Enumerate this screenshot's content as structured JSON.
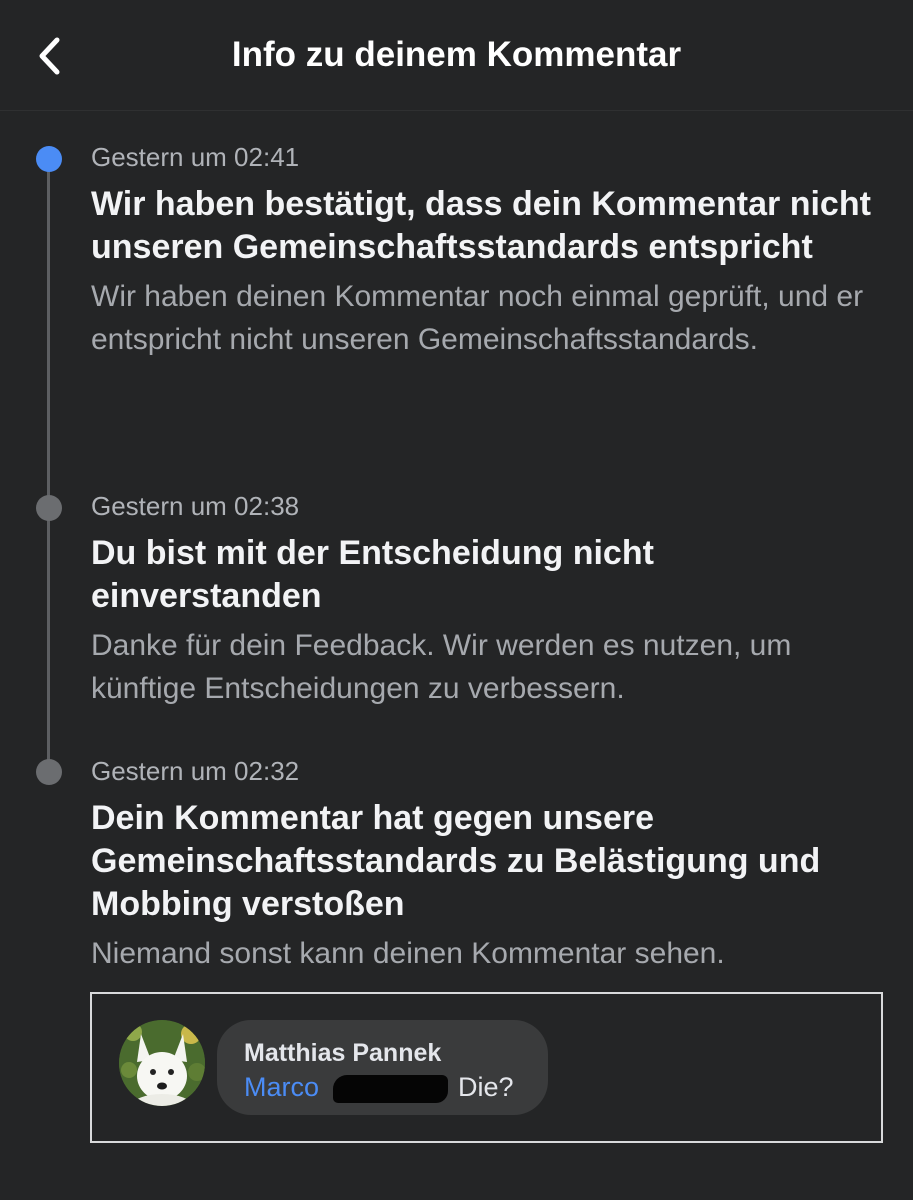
{
  "header": {
    "title": "Info zu deinem Kommentar",
    "back_icon": "chevron-left-icon"
  },
  "timeline": [
    {
      "timestamp": "Gestern um 02:41",
      "title": "Wir haben bestätigt, dass dein Kommentar nicht unseren Gemeinschaftsstandards entspricht",
      "description": "Wir haben deinen Kommentar noch einmal geprüft, und er entspricht nicht unseren Gemeinschaftsstandards.",
      "active": true
    },
    {
      "timestamp": "Gestern um 02:38",
      "title": "Du bist mit der Entscheidung nicht einverstanden",
      "description": "Danke für dein Feedback. Wir werden es nutzen, um künftige Entscheidungen zu verbessern.",
      "active": false
    },
    {
      "timestamp": "Gestern um 02:32",
      "title": "Dein Kommentar hat gegen unsere Gemeinschaftsstandards zu Belästigung und Mobbing verstoßen",
      "description": "Niemand sonst kann deinen Kommentar sehen.",
      "active": false
    }
  ],
  "comment": {
    "author": "Matthias Pannek",
    "mention": "Marco",
    "text": "Die?"
  },
  "colors": {
    "background": "#242526",
    "accent": "#4b8cf5",
    "dot_inactive": "#6b6d70",
    "bubble": "#3a3b3c"
  }
}
